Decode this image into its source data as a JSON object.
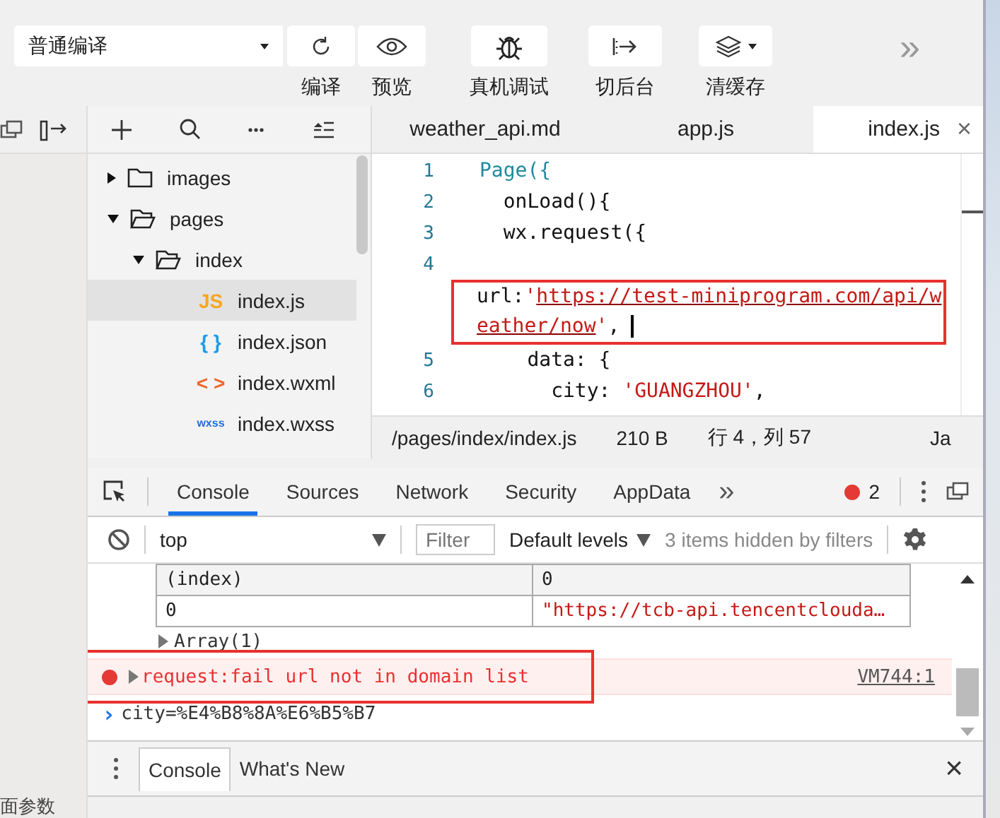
{
  "toolbar": {
    "compile_mode": "普通编译",
    "buttons": [
      {
        "kind": "refresh",
        "label": "编译"
      },
      {
        "kind": "eye",
        "label": "预览"
      },
      {
        "kind": "bug",
        "label": "真机调试"
      },
      {
        "kind": "background",
        "label": "切后台"
      },
      {
        "kind": "layers",
        "label": "清缓存"
      }
    ],
    "more": "»"
  },
  "file_tree": [
    {
      "name": "images",
      "kind": "folder",
      "expanded": false,
      "selected": false
    },
    {
      "name": "pages",
      "kind": "folder",
      "expanded": true,
      "selected": false,
      "children": [
        {
          "name": "index",
          "kind": "folder",
          "expanded": true,
          "selected": false,
          "children": [
            {
              "name": "index.js",
              "kind": "file",
              "badge": "JS",
              "color": "#f5a623",
              "selected": true
            },
            {
              "name": "index.json",
              "kind": "file",
              "badge": "{ }",
              "color": "#1e9be8",
              "selected": false
            },
            {
              "name": "index.wxml",
              "kind": "file",
              "badge": "< >",
              "color": "#f06428",
              "selected": false
            },
            {
              "name": "index.wxss",
              "kind": "file",
              "badge": "wxss",
              "color": "#1e6fd9",
              "selected": false
            }
          ]
        }
      ]
    }
  ],
  "editor": {
    "tabs": [
      {
        "label": "weather_api.md",
        "selected": false
      },
      {
        "label": "app.js",
        "selected": false
      },
      {
        "label": "index.js",
        "selected": true,
        "close": "×"
      }
    ],
    "lines": [
      {
        "number": "1",
        "highlighted": false,
        "tokens": [
          {
            "kind": "fn",
            "text": "Page({"
          }
        ]
      },
      {
        "number": "2",
        "highlighted": false,
        "tokens": [
          {
            "kind": "plain",
            "text": "  onLoad(){"
          }
        ]
      },
      {
        "number": "3",
        "highlighted": false,
        "tokens": [
          {
            "kind": "plain",
            "text": "  wx.request({"
          }
        ]
      },
      {
        "number": "4",
        "highlighted": true,
        "tokens": [
          {
            "kind": "plain",
            "text": "url:"
          },
          {
            "kind": "string",
            "text": "'"
          },
          {
            "kind": "link",
            "text": "https://test-miniprogram.com/api/weather/now"
          },
          {
            "kind": "string",
            "text": "'"
          },
          {
            "kind": "plain",
            "text": ","
          }
        ]
      },
      {
        "number": "5",
        "highlighted": false,
        "tokens": [
          {
            "kind": "plain",
            "text": "    data: {"
          }
        ]
      },
      {
        "number": "6",
        "highlighted": false,
        "tokens": [
          {
            "kind": "plain",
            "text": "      city: "
          },
          {
            "kind": "string",
            "text": "'GUANGZHOU'"
          },
          {
            "kind": "plain",
            "text": ","
          }
        ]
      }
    ],
    "status_bar": {
      "path": "/pages/index/index.js",
      "size": "210 B",
      "position": "行 4，列 57",
      "language": "Ja"
    }
  },
  "devtools": {
    "tabs": [
      {
        "label": "Console",
        "selected": true
      },
      {
        "label": "Sources",
        "selected": false
      },
      {
        "label": "Network",
        "selected": false
      },
      {
        "label": "Security",
        "selected": false
      },
      {
        "label": "AppData",
        "selected": false
      }
    ],
    "more": "»",
    "error_count": "2",
    "filter_bar": {
      "context": "top",
      "filter_placeholder": "Filter",
      "levels": "Default levels",
      "hidden_note": "3 items hidden by filters"
    },
    "table": {
      "columns": [
        "(index)",
        "0"
      ],
      "rows": [
        [
          "0",
          "\"https://tcb-api.tencentclouda…"
        ]
      ]
    },
    "array_label": "Array(1)",
    "error": {
      "message": "request:fail url not in domain list",
      "source": "VM744:1"
    },
    "result": {
      "prompt": "›",
      "text": "city=%E4%B8%8A%E6%B5%B7"
    },
    "drawer_tabs": [
      {
        "label": "Console",
        "selected": true
      },
      {
        "label": "What's New",
        "selected": false
      }
    ],
    "drawer_close": "×"
  },
  "footer_text": "面参数"
}
